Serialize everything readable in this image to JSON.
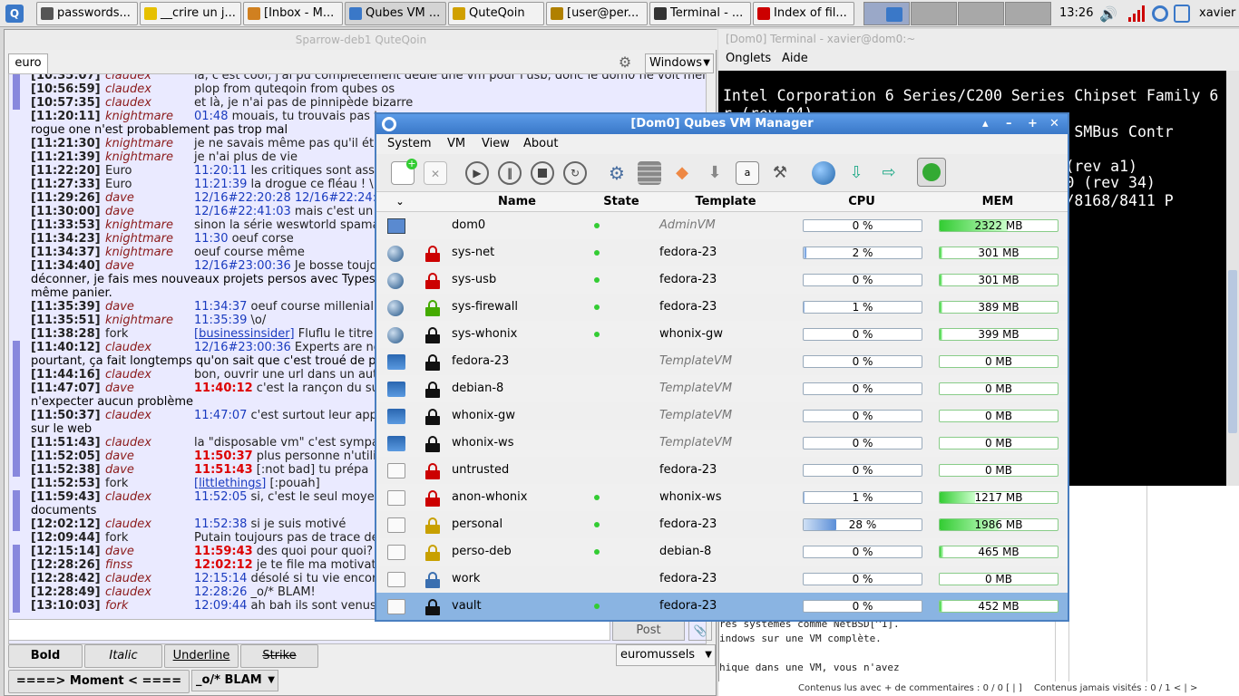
{
  "taskbar": {
    "tasks": [
      {
        "label": "passwords..."
      },
      {
        "label": "__crire un j..."
      },
      {
        "label": "[Inbox - M..."
      },
      {
        "label": "Qubes VM ..."
      },
      {
        "label": "QuteQoin"
      },
      {
        "label": "[user@per..."
      },
      {
        "label": "Terminal - ..."
      },
      {
        "label": "Index of fil..."
      }
    ],
    "clock": "13:26",
    "user": "xavier"
  },
  "chat": {
    "title": "Sparrow-deb1 QuteQoin",
    "tab": "euro",
    "windows_select": "Windows",
    "lines": [
      {
        "time": "[10:35:07]",
        "nick": "claudex",
        "text": "la, c'est cool, j'ai pu complètement dédié une vm pour l'usb, donc le dom0 ne voit mem",
        "bar": true
      },
      {
        "time": "[10:56:59]",
        "nick": "claudex",
        "text": "plop from quteqoin from qubes os",
        "bar": true
      },
      {
        "time": "[10:57:35]",
        "nick": "claudex",
        "text": "et là, je n'ai pas de pinnipède bizarre",
        "bar": true
      },
      {
        "time": "[11:20:11]",
        "nick": "knightmare",
        "ts": "01:48",
        "text": " mouais, tu trouvais pas t",
        "bar": false
      },
      {
        "time": "",
        "nick": "",
        "text": "rogue one n'est probablement pas trop mal",
        "bar": false,
        "cont": true
      },
      {
        "time": "[11:21:30]",
        "nick": "knightmare",
        "text": "je ne savais même pas qu'il éta",
        "bar": false
      },
      {
        "time": "[11:21:39]",
        "nick": "knightmare",
        "text": "je n'ai plus de vie",
        "bar": false
      },
      {
        "time": "[11:22:20]",
        "nick": "Euro",
        "ts": "11:20:11",
        "text": " les critiques sont asse",
        "bar": false,
        "plain": true
      },
      {
        "time": "[11:27:33]",
        "nick": "Euro",
        "ts": "11:21:39",
        "text": " la drogue ce fléau ! \\",
        "bar": false,
        "plain": true
      },
      {
        "time": "[11:29:26]",
        "nick": "dave",
        "ts": "12/16#22:20:28 12/16#22:24:",
        "text": "",
        "bar": false
      },
      {
        "time": "[11:30:00]",
        "nick": "dave",
        "ts": "12/16#22:41:03",
        "text": " mais c'est un",
        "bar": false
      },
      {
        "time": "[11:33:53]",
        "nick": "knightmare",
        "text": "sinon la série weswtorld spama",
        "bar": false
      },
      {
        "time": "[11:34:23]",
        "nick": "knightmare",
        "ts": "11:30",
        "text": " oeuf corse",
        "bar": false
      },
      {
        "time": "[11:34:37]",
        "nick": "knightmare",
        "text": "oeuf course même",
        "bar": false
      },
      {
        "time": "[11:34:40]",
        "nick": "dave",
        "ts": "12/16#23:00:36",
        "text": " Je bosse toujo",
        "bar": false
      },
      {
        "time": "",
        "nick": "",
        "text": "déconner, je fais mes nouveaux projets persos avec Typesc",
        "bar": false,
        "cont": true
      },
      {
        "time": "",
        "nick": "",
        "text": "même panier.",
        "bar": false,
        "cont": true
      },
      {
        "time": "[11:35:39]",
        "nick": "dave",
        "ts": "11:34:37",
        "text": " oeuf course millenial!",
        "bar": false
      },
      {
        "time": "[11:35:51]",
        "nick": "knightmare",
        "ts": "11:35:39",
        "text": " \\o/",
        "bar": false
      },
      {
        "time": "[11:38:28]",
        "nick": "fork",
        "link": "[businessinsider]",
        "text": " Fluflu le titre e",
        "bar": false,
        "plain": true
      },
      {
        "time": "[11:40:12]",
        "nick": "claudex",
        "ts": "12/16#23:00:36",
        "text": " Experts are no",
        "bar": true
      },
      {
        "time": "",
        "nick": "",
        "text": "pourtant, ça fait longtemps qu'on sait que c'est troué de pa",
        "bar": true,
        "cont": true
      },
      {
        "time": "[11:44:16]",
        "nick": "claudex",
        "text": "bon, ouvrir une url dans un aut",
        "bar": true
      },
      {
        "time": "[11:47:07]",
        "nick": "dave",
        "tsr": "11:40:12",
        "text": " c'est la rançon du su",
        "bar": true
      },
      {
        "time": "",
        "nick": "",
        "text": "n'expecter aucun problème",
        "bar": true,
        "cont": true
      },
      {
        "time": "[11:50:37]",
        "nick": "claudex",
        "ts": "11:47:07",
        "text": " c'est surtout leur app",
        "bar": true
      },
      {
        "time": "",
        "nick": "",
        "text": "sur le web",
        "bar": true,
        "cont": true
      },
      {
        "time": "[11:51:43]",
        "nick": "claudex",
        "text": "la \"disposable vm\" c'est sympa",
        "bar": true
      },
      {
        "time": "[11:52:05]",
        "nick": "dave",
        "tsr": "11:50:37",
        "text": " plus personne n'utilis",
        "bar": true
      },
      {
        "time": "[11:52:38]",
        "nick": "dave",
        "tsr": "11:51:43",
        "text": " [:not bad] tu prépa",
        "bar": true
      },
      {
        "time": "[11:52:53]",
        "nick": "fork",
        "link": "[littlethings]",
        "text": " [:pouah]",
        "bar": false,
        "plain": true
      },
      {
        "time": "[11:59:43]",
        "nick": "claudex",
        "ts": "11:52:05",
        "text": " si, c'est le seul moyen",
        "bar": true
      },
      {
        "time": "",
        "nick": "",
        "text": "documents",
        "bar": true,
        "cont": true
      },
      {
        "time": "[12:02:12]",
        "nick": "claudex",
        "ts": "11:52:38",
        "text": " si je suis motivé",
        "bar": true
      },
      {
        "time": "[12:09:44]",
        "nick": "fork",
        "text": "Putain toujours pas de trace de",
        "bar": false,
        "plain": true
      },
      {
        "time": "[12:15:14]",
        "nick": "dave",
        "tsr": "11:59:43",
        "text": " des quoi pour quoi?",
        "bar": true
      },
      {
        "time": "[12:28:26]",
        "nick": "finss",
        "tsr": "12:02:12",
        "text": " je te file ma motivat",
        "bar": true
      },
      {
        "time": "[12:28:42]",
        "nick": "claudex",
        "ts": "12:15:14",
        "text": " désolé si tu vie encor",
        "bar": true
      },
      {
        "time": "[12:28:49]",
        "nick": "claudex",
        "ts": "12:28:26",
        "text": " _o/* BLAM!",
        "bar": true
      },
      {
        "time": "[13:10:03]",
        "nick": "fork",
        "ts": "12:09:44",
        "text": " ah bah ils sont venus",
        "bar": true
      }
    ],
    "post_label": "Post",
    "fmt": {
      "bold": "Bold",
      "italic": "Italic",
      "underline": "Underline",
      "strike": "Strike"
    },
    "board_select": "euromussels",
    "moment": "====> Moment < ====",
    "blam": "_o/* BLAM"
  },
  "terminal": {
    "title": "[Dom0] Terminal - xavier@dom0:~",
    "menu": [
      "Onglets",
      "Aide"
    ],
    "lines": [
      "Intel Corporation 6 Series/C200 Series Chipset Family 6",
      "r (rev 04)",
      "                                 amily SMBus Contr",
      "                                 0MX] (rev a1)",
      "                                 -N 130 (rev 34)",
      "                                 L8111/8168/8411 P"
    ]
  },
  "doc": {
    "lines": [
      "res systèmes comme NetBSD[^1].",
      "indows sur une VM complète.",
      "",
      "hique dans une VM, vous n'avez"
    ],
    "status_left": "Contenus lus avec + de commentaires : 0 / 0 [ | ]",
    "status_right": "Contenus jamais visités : 0 / 1 < | >"
  },
  "manager": {
    "title": "[Dom0] Qubes VM Manager",
    "menu": [
      "System",
      "VM",
      "View",
      "About"
    ],
    "columns": {
      "name": "Name",
      "state": "State",
      "template": "Template",
      "cpu": "CPU",
      "mem": "MEM"
    },
    "colors": {
      "running": "#33cc33",
      "red": "#cc0000",
      "green": "#44aa00",
      "black": "#111111",
      "yellow": "#c8a000",
      "blue": "#3a6fb0"
    },
    "vms": [
      {
        "name": "dom0",
        "running": true,
        "template": "AdminVM",
        "template_italic": true,
        "cpu_pct": 0,
        "cpu": "0 %",
        "mem_frac": 0.58,
        "mem": "2322 MB",
        "lock": "none",
        "icon": "dom0-icon"
      },
      {
        "name": "sys-net",
        "running": true,
        "template": "fedora-23",
        "cpu_pct": 2,
        "cpu": "2 %",
        "mem_frac": 0.02,
        "mem": "301 MB",
        "lock": "red",
        "icon": "netvm-icon"
      },
      {
        "name": "sys-usb",
        "running": true,
        "template": "fedora-23",
        "cpu_pct": 0,
        "cpu": "0 %",
        "mem_frac": 0.02,
        "mem": "301 MB",
        "lock": "red",
        "icon": "netvm-icon"
      },
      {
        "name": "sys-firewall",
        "running": true,
        "template": "fedora-23",
        "cpu_pct": 1,
        "cpu": "1 %",
        "mem_frac": 0.02,
        "mem": "389 MB",
        "lock": "green",
        "icon": "proxyvm-icon"
      },
      {
        "name": "sys-whonix",
        "running": true,
        "template": "whonix-gw",
        "cpu_pct": 0,
        "cpu": "0 %",
        "mem_frac": 0.02,
        "mem": "399 MB",
        "lock": "black",
        "icon": "proxyvm-icon"
      },
      {
        "name": "fedora-23",
        "running": false,
        "template": "TemplateVM",
        "template_italic": true,
        "cpu_pct": 0,
        "cpu": "0 %",
        "mem_frac": 0,
        "mem": "0 MB",
        "lock": "black",
        "icon": "templatevm-icon"
      },
      {
        "name": "debian-8",
        "running": false,
        "template": "TemplateVM",
        "template_italic": true,
        "cpu_pct": 0,
        "cpu": "0 %",
        "mem_frac": 0,
        "mem": "0 MB",
        "lock": "black",
        "icon": "templatevm-icon"
      },
      {
        "name": "whonix-gw",
        "running": false,
        "template": "TemplateVM",
        "template_italic": true,
        "cpu_pct": 0,
        "cpu": "0 %",
        "mem_frac": 0,
        "mem": "0 MB",
        "lock": "black",
        "icon": "templatevm-icon"
      },
      {
        "name": "whonix-ws",
        "running": false,
        "template": "TemplateVM",
        "template_italic": true,
        "cpu_pct": 0,
        "cpu": "0 %",
        "mem_frac": 0,
        "mem": "0 MB",
        "lock": "black",
        "icon": "templatevm-icon"
      },
      {
        "name": "untrusted",
        "running": false,
        "template": "fedora-23",
        "cpu_pct": 0,
        "cpu": "0 %",
        "mem_frac": 0,
        "mem": "0 MB",
        "lock": "red",
        "icon": "appvm-icon"
      },
      {
        "name": "anon-whonix",
        "running": true,
        "template": "whonix-ws",
        "cpu_pct": 1,
        "cpu": "1 %",
        "mem_frac": 0.3,
        "mem": "1217 MB",
        "lock": "red",
        "icon": "appvm-icon"
      },
      {
        "name": "personal",
        "running": true,
        "template": "fedora-23",
        "cpu_pct": 28,
        "cpu": "28 %",
        "mem_frac": 0.5,
        "mem": "1986 MB",
        "lock": "yellow",
        "icon": "appvm-icon"
      },
      {
        "name": "perso-deb",
        "running": true,
        "template": "debian-8",
        "cpu_pct": 0,
        "cpu": "0 %",
        "mem_frac": 0.03,
        "mem": "465 MB",
        "lock": "yellow",
        "icon": "appvm-icon"
      },
      {
        "name": "work",
        "running": false,
        "template": "fedora-23",
        "cpu_pct": 0,
        "cpu": "0 %",
        "mem_frac": 0,
        "mem": "0 MB",
        "lock": "blue",
        "icon": "appvm-icon"
      },
      {
        "name": "vault",
        "running": true,
        "template": "fedora-23",
        "cpu_pct": 0,
        "cpu": "0 %",
        "mem_frac": 0.02,
        "mem": "452 MB",
        "lock": "black",
        "icon": "appvm-icon",
        "selected": true
      }
    ]
  }
}
